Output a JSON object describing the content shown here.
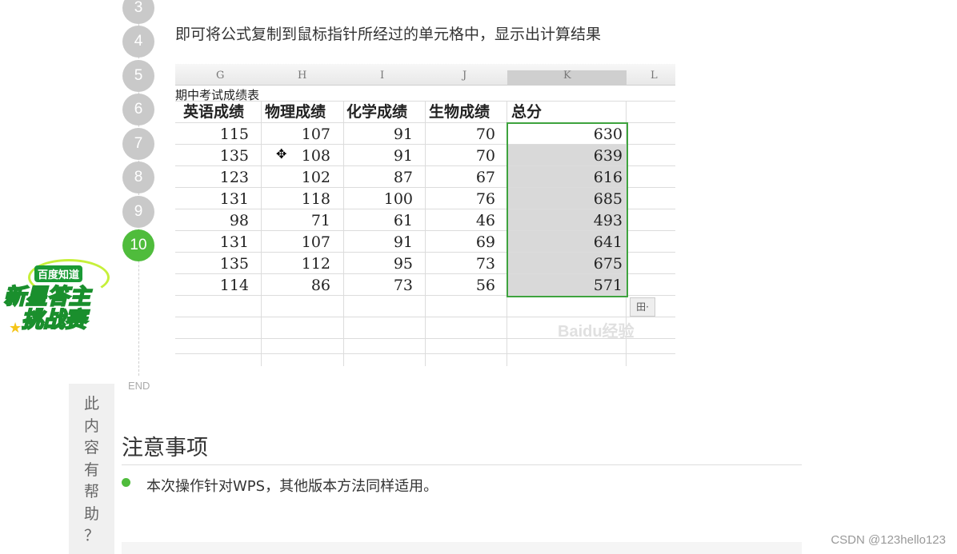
{
  "steps": [
    "3",
    "4",
    "5",
    "6",
    "7",
    "8",
    "9",
    "10"
  ],
  "end_label": "END",
  "step_text": "即可将公式复制到鼠标指针所经过的单元格中，显示出计算结果",
  "sheet": {
    "columns": [
      "G",
      "H",
      "I",
      "J",
      "K",
      "L"
    ],
    "title": "期中考试成绩表",
    "headers": [
      "英语成绩",
      "物理成绩",
      "化学成绩",
      "生物成绩",
      "总分"
    ],
    "rows": [
      [
        "115",
        "107",
        "91",
        "70",
        "630"
      ],
      [
        "135",
        "108",
        "91",
        "70",
        "639"
      ],
      [
        "123",
        "102",
        "87",
        "67",
        "616"
      ],
      [
        "131",
        "118",
        "100",
        "76",
        "685"
      ],
      [
        "98",
        "71",
        "61",
        "46",
        "493"
      ],
      [
        "131",
        "107",
        "91",
        "69",
        "641"
      ],
      [
        "135",
        "112",
        "95",
        "73",
        "675"
      ],
      [
        "114",
        "86",
        "73",
        "56",
        "571"
      ]
    ],
    "autofill_icon": "田·",
    "watermark": "Baidu经验",
    "selection_color": "#3ea33e"
  },
  "badge": {
    "line1": "百度知道",
    "line2": "新星答主",
    "line3": "挑战赛"
  },
  "feedback_chars": [
    "此",
    "内",
    "容",
    "有",
    "帮",
    "助",
    "？"
  ],
  "notes": {
    "title": "注意事项",
    "item": "本次操作针对WPS，其他版本方法同样适用。"
  },
  "credit": "CSDN @123hello123",
  "colors": {
    "accent": "#4fbc3c",
    "step_inactive": "#c9c9c9"
  }
}
